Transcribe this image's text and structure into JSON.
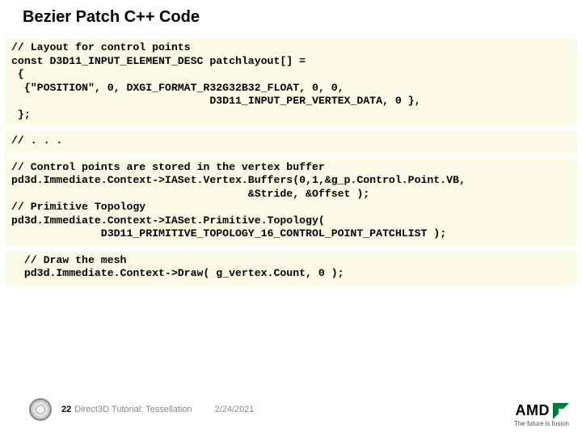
{
  "title": "Bezier Patch C++ Code",
  "code": {
    "block1": "// Layout for control points\nconst D3D11_INPUT_ELEMENT_DESC patchlayout[] =\n {\n  {\"POSITION\", 0, DXGI_FORMAT_R32G32B32_FLOAT, 0, 0,\n                               D3D11_INPUT_PER_VERTEX_DATA, 0 },\n };",
    "block2": "// . . .",
    "block3": "// Control points are stored in the vertex buffer\npd3d.Immediate.Context->IASet.Vertex.Buffers(0,1,&g_p.Control.Point.VB,\n                                     &Stride, &Offset );\n// Primitive Topology\npd3d.Immediate.Context->IASet.Primitive.Topology(\n              D3D11_PRIMITIVE_TOPOLOGY_16_CONTROL_POINT_PATCHLIST );",
    "block4": "  // Draw the mesh\n  pd3d.Immediate.Context->Draw( g_vertex.Count, 0 );"
  },
  "footer": {
    "slide_number": "22",
    "tutorial": "Direct3D Tutorial: Tessellation",
    "date": "2/24/2021"
  },
  "brand": {
    "name": "AMD",
    "tagline": "The future is fusion"
  }
}
